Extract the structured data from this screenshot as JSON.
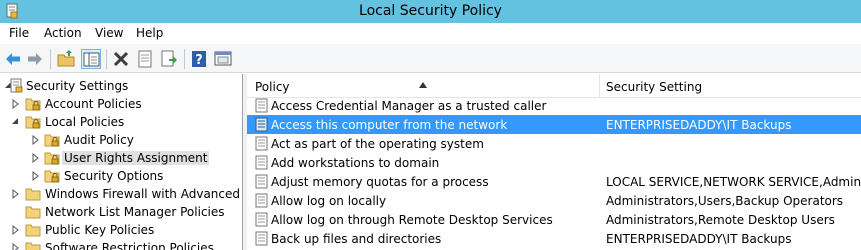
{
  "window": {
    "title": "Local Security Policy",
    "app_icon": "security-policy-app-icon"
  },
  "menu": {
    "items": [
      "File",
      "Action",
      "View",
      "Help"
    ]
  },
  "toolbar": {
    "buttons": [
      "back-arrow-icon",
      "forward-arrow-icon",
      "up-folder-icon",
      "show-hide-tree-icon",
      "delete-icon",
      "properties-icon",
      "export-list-icon",
      "help-icon",
      "console-view-icon"
    ]
  },
  "tree": {
    "items": [
      {
        "label": "Security Settings",
        "icon": "security-settings-icon",
        "expand": "expanded"
      },
      {
        "label": "Account Policies",
        "icon": "locked-folder-icon",
        "expand": "collapsed"
      },
      {
        "label": "Local Policies",
        "icon": "locked-folder-icon",
        "expand": "expanded"
      },
      {
        "label": "Audit Policy",
        "icon": "locked-folder-icon",
        "expand": "collapsed"
      },
      {
        "label": "User Rights Assignment",
        "icon": "locked-folder-icon",
        "expand": "collapsed",
        "selected": true
      },
      {
        "label": "Security Options",
        "icon": "locked-folder-icon",
        "expand": "collapsed"
      },
      {
        "label": "Windows Firewall with Advanced Secu",
        "icon": "folder-icon",
        "expand": "collapsed"
      },
      {
        "label": "Network List Manager Policies",
        "icon": "folder-icon",
        "expand": "none"
      },
      {
        "label": "Public Key Policies",
        "icon": "folder-icon",
        "expand": "collapsed"
      },
      {
        "label": "Software Restriction Policies",
        "icon": "folder-icon",
        "expand": "collapsed"
      }
    ]
  },
  "list": {
    "columns": [
      "Policy",
      "Security Setting"
    ],
    "sort_column": "Policy",
    "sort_direction": "ascending",
    "rows": [
      {
        "policy": "Access Credential Manager as a trusted caller",
        "setting": ""
      },
      {
        "policy": "Access this computer from the network",
        "setting": "ENTERPRISEDADDY\\IT Backups",
        "selected": true
      },
      {
        "policy": "Act as part of the operating system",
        "setting": ""
      },
      {
        "policy": "Add workstations to domain",
        "setting": ""
      },
      {
        "policy": "Adjust memory quotas for a process",
        "setting": "LOCAL SERVICE,NETWORK SERVICE,Administrato"
      },
      {
        "policy": "Allow log on locally",
        "setting": "Administrators,Users,Backup Operators"
      },
      {
        "policy": "Allow log on through Remote Desktop Services",
        "setting": "Administrators,Remote Desktop Users"
      },
      {
        "policy": "Back up files and directories",
        "setting": "ENTERPRISEDADDY\\IT Backups"
      }
    ]
  },
  "colors": {
    "titlebar": "#62c2e0",
    "selection": "#3399ff",
    "tree_selection": "#e0e0e0"
  }
}
